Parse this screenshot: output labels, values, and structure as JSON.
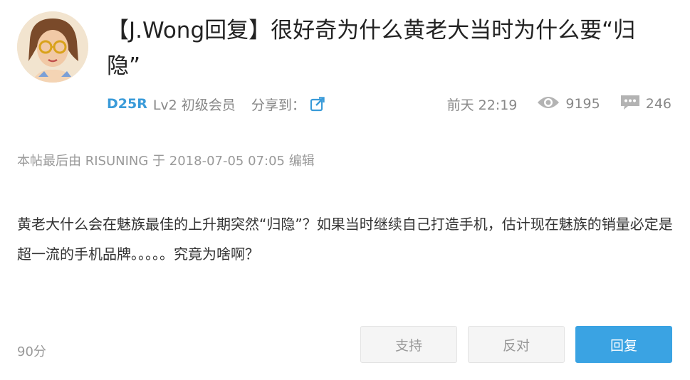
{
  "post": {
    "title": "【J.Wong回复】很好奇为什么黄老大当时为什么要“归隐”",
    "author": "D25R",
    "level": "Lv2 初级会员",
    "share_label": "分享到：",
    "time": "前天 22:19",
    "views": "9195",
    "replies": "246",
    "edited_note": "本帖最后由 RISUNING 于 2018-07-05 07:05 编辑",
    "body": "黄老大什么会在魅族最佳的上升期突然“归隐”？如果当时继续自己打造手机，估计现在魅族的销量必定是超一流的手机品牌。。。。。究竟为啥啊？",
    "score": "90分"
  },
  "actions": {
    "support_label": "支持",
    "oppose_label": "反对",
    "reply_label": "回复"
  },
  "icons": {
    "avatar": "avatar-icon",
    "share": "share-icon",
    "views": "eye-icon",
    "replies": "comment-icon"
  },
  "colors": {
    "author": "#3a9bd9",
    "reply_button": "#3aa3e3",
    "muted_text": "#888888"
  }
}
